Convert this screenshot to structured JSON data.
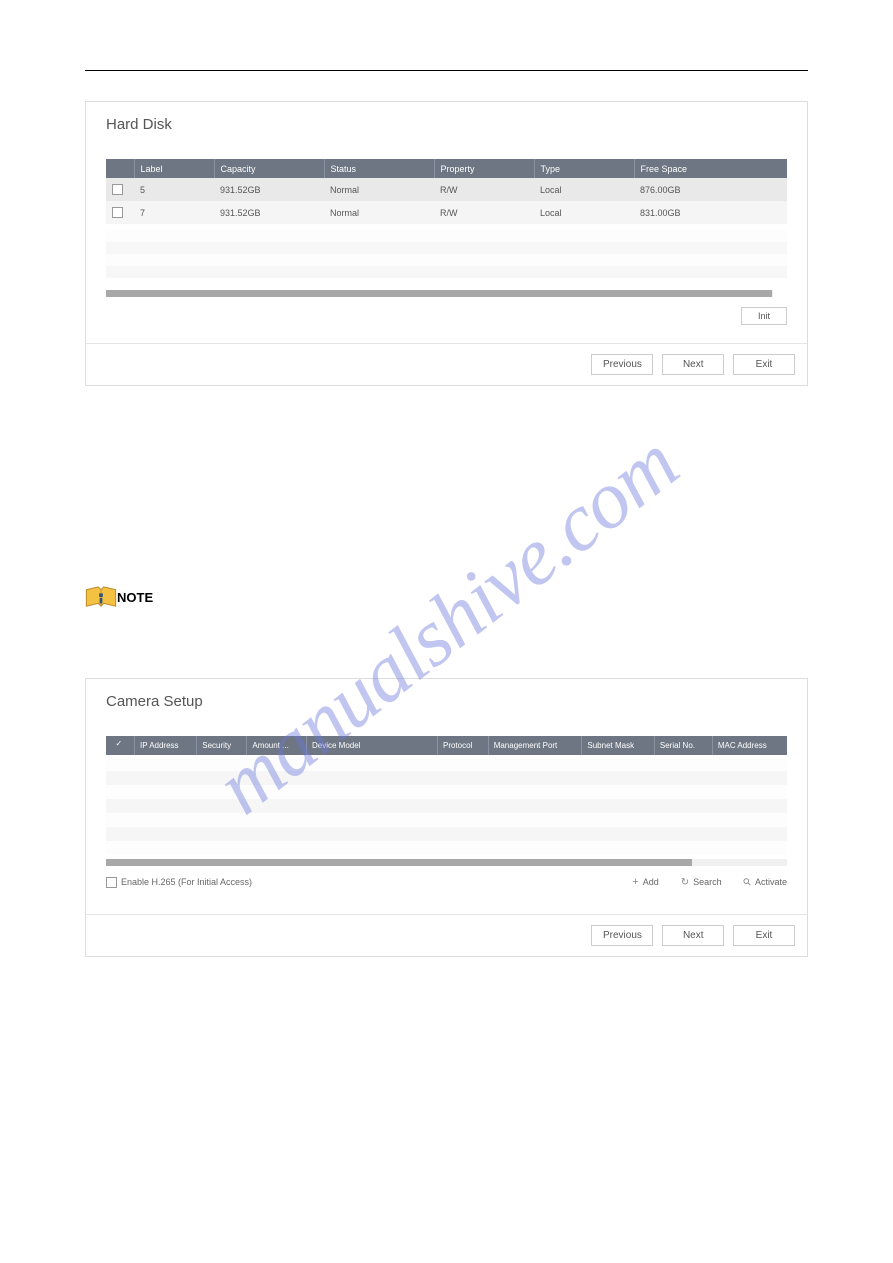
{
  "watermark": "manualshive.com",
  "note_label": "NOTE",
  "hard_disk": {
    "title": "Hard Disk",
    "headers": {
      "label": "Label",
      "capacity": "Capacity",
      "status": "Status",
      "property": "Property",
      "type": "Type",
      "free_space": "Free Space"
    },
    "rows": [
      {
        "label": "5",
        "capacity": "931.52GB",
        "status": "Normal",
        "property": "R/W",
        "type": "Local",
        "free_space": "876.00GB"
      },
      {
        "label": "7",
        "capacity": "931.52GB",
        "status": "Normal",
        "property": "R/W",
        "type": "Local",
        "free_space": "831.00GB"
      }
    ],
    "init_btn": "Init",
    "previous_btn": "Previous",
    "next_btn": "Next",
    "exit_btn": "Exit"
  },
  "camera_setup": {
    "title": "Camera Setup",
    "headers": {
      "ip": "IP Address",
      "security": "Security",
      "amount": "Amount ...",
      "model": "Device Model",
      "protocol": "Protocol",
      "mgmt_port": "Management Port",
      "subnet": "Subnet Mask",
      "serial": "Serial No.",
      "mac": "MAC Address"
    },
    "enable_h265": "Enable H.265 (For Initial Access)",
    "add_btn": "Add",
    "search_btn": "Search",
    "activate_btn": "Activate",
    "previous_btn": "Previous",
    "next_btn": "Next",
    "exit_btn": "Exit"
  }
}
